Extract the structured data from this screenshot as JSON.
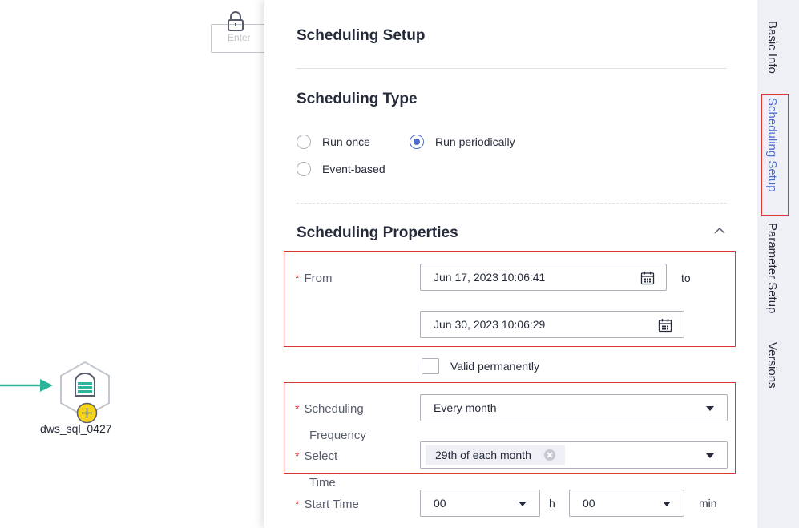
{
  "canvas": {
    "search_placeholder": "Enter",
    "node_label": "dws_sql_0427"
  },
  "panel": {
    "title": "Scheduling Setup",
    "scheduling_type": {
      "title": "Scheduling Type",
      "options": [
        "Run once",
        "Run periodically",
        "Event-based"
      ],
      "selected": "Run periodically"
    },
    "scheduling_properties": {
      "title": "Scheduling Properties",
      "from_label": "From",
      "from_value": "Jun 17, 2023 10:06:41",
      "to_label": "to",
      "to_value": "Jun 30, 2023 10:06:29",
      "valid_permanently_label": "Valid permanently",
      "frequency_label_line1": "Scheduling",
      "frequency_label_line2": "Frequency",
      "frequency_value": "Every month",
      "select_label": "Select",
      "select_tag": "29th of each month",
      "time_label": "Time",
      "start_time_label": "Start Time",
      "start_hour": "00",
      "hour_unit": "h",
      "start_min": "00",
      "min_unit": "min"
    }
  },
  "side_tabs": [
    "Basic Info",
    "Scheduling Setup",
    "Parameter Setup",
    "Versions"
  ],
  "active_tab": "Scheduling Setup",
  "colors": {
    "accent": "#526ecc",
    "required": "#e13636",
    "node_green": "#2db59c"
  }
}
